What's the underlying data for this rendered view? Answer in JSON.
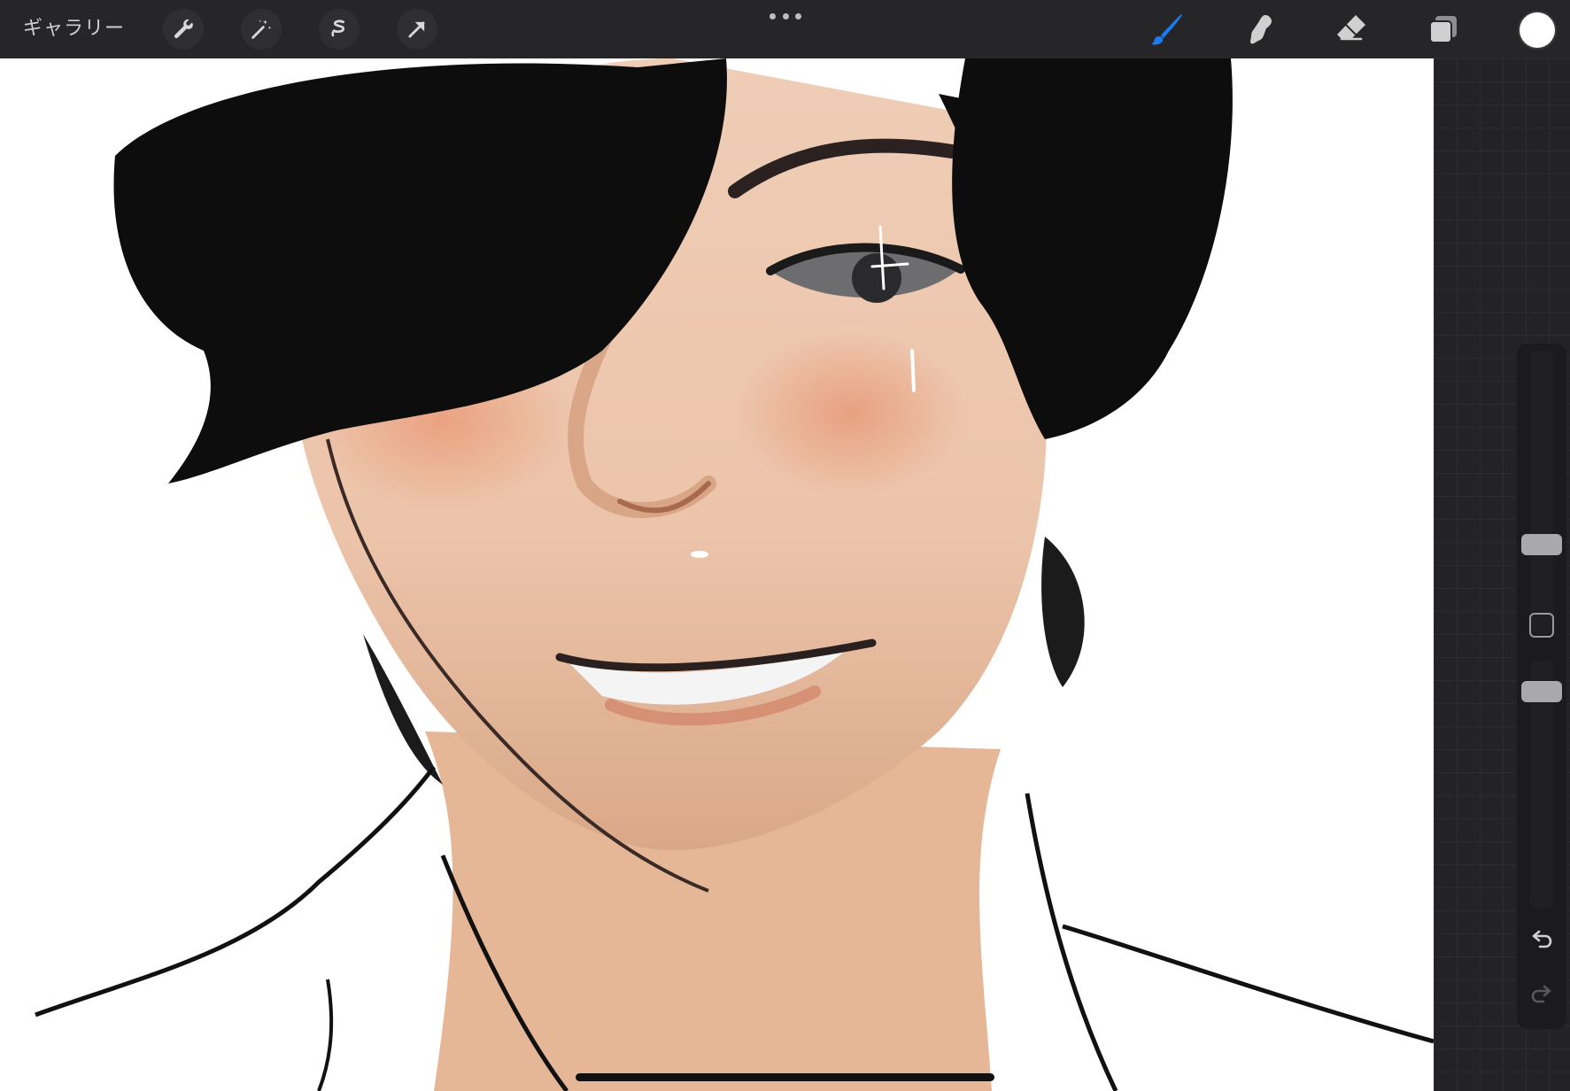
{
  "toolbar": {
    "gallery_label": "ギャラリー",
    "left_tools": [
      "wrench-icon",
      "magic-wand-icon",
      "selection-icon",
      "transform-arrow-icon"
    ],
    "right_tools": [
      "brush-icon",
      "smudge-icon",
      "eraser-icon",
      "layers-icon"
    ],
    "active_tool": "brush",
    "accent_color": "#1a7cf5",
    "current_color": "#ffffff"
  },
  "sidebar": {
    "brush_size_level": 0.3,
    "opacity_level": 0.91
  },
  "canvas": {
    "background": "#ffffff"
  }
}
